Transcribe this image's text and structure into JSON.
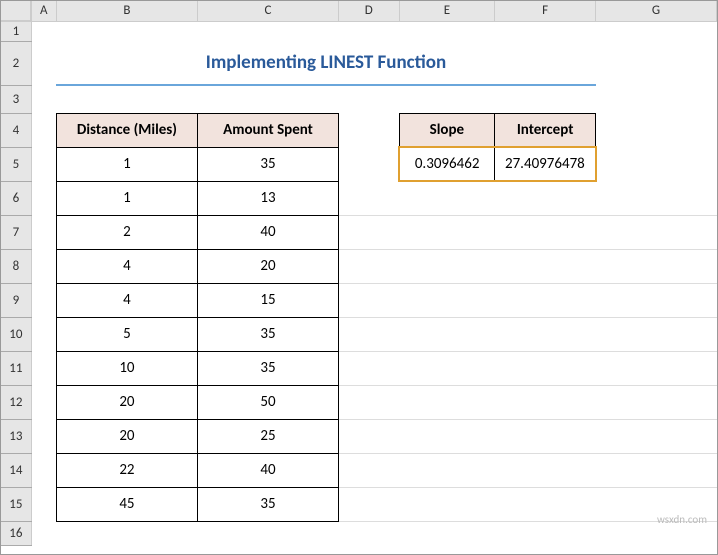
{
  "cols": [
    "A",
    "B",
    "C",
    "D",
    "E",
    "F",
    "G"
  ],
  "rows": [
    "1",
    "2",
    "3",
    "4",
    "5",
    "6",
    "7",
    "8",
    "9",
    "10",
    "11",
    "12",
    "13",
    "14",
    "15",
    "16"
  ],
  "title": "Implementing LINEST Function",
  "headers": {
    "distance": "Distance (Miles)",
    "amount": "Amount Spent",
    "slope": "Slope",
    "intercept": "Intercept"
  },
  "data": [
    {
      "distance": "1",
      "amount": "35"
    },
    {
      "distance": "1",
      "amount": "13"
    },
    {
      "distance": "2",
      "amount": "40"
    },
    {
      "distance": "4",
      "amount": "20"
    },
    {
      "distance": "4",
      "amount": "15"
    },
    {
      "distance": "5",
      "amount": "35"
    },
    {
      "distance": "10",
      "amount": "35"
    },
    {
      "distance": "20",
      "amount": "50"
    },
    {
      "distance": "20",
      "amount": "25"
    },
    {
      "distance": "22",
      "amount": "40"
    },
    {
      "distance": "45",
      "amount": "35"
    }
  ],
  "result": {
    "slope": "0.3096462",
    "intercept": "27.40976478"
  },
  "watermark": "wsxdn.com",
  "chart_data": {
    "type": "table",
    "title": "Implementing LINEST Function",
    "series": [
      {
        "name": "Distance (Miles)",
        "values": [
          1,
          1,
          2,
          4,
          4,
          5,
          10,
          20,
          20,
          22,
          45
        ]
      },
      {
        "name": "Amount Spent",
        "values": [
          35,
          13,
          40,
          20,
          15,
          35,
          35,
          50,
          25,
          40,
          35
        ]
      }
    ],
    "linest_output": {
      "slope": 0.3096462,
      "intercept": 27.40976478
    }
  }
}
